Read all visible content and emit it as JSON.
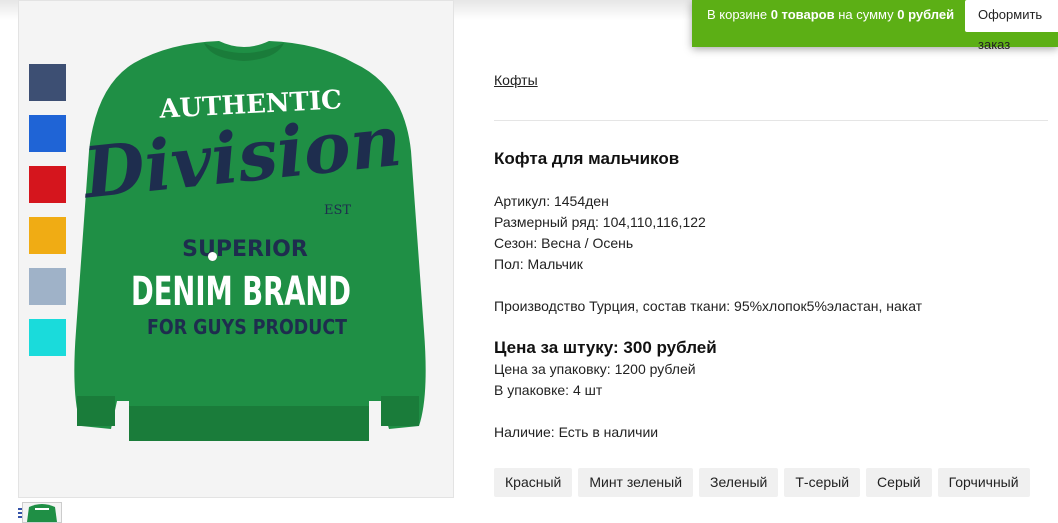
{
  "cart": {
    "prefix": "В корзине",
    "count": "0 товаров",
    "middle": "на сумму",
    "sum": "0 рублей",
    "checkout_label": "Оформить заказ"
  },
  "breadcrumb": "Кофты",
  "product": {
    "title": "Кофта для мальчиков",
    "article": "Артикул: 1454ден",
    "sizes": "Размерный ряд: 104,110,116,122",
    "season": "Сезон: Весна / Осень",
    "gender": "Пол: Мальчик",
    "composition": "Производство Турция, состав ткани: 95%хлопок5%эластан, накат",
    "price_piece": "Цена за штуку: 300 рублей",
    "price_pack": "Цена за упаковку: 1200 рублей",
    "pack_qty": "В упаковке: 4 шт",
    "availability": "Наличие: Есть в наличии"
  },
  "image_print": {
    "authentic": "AUTHENTIC",
    "division": "Division",
    "est": "EST",
    "superior": "SUPERIOR",
    "denim": "DENIM BRAND",
    "for_guys": "FOR GUYS PRODUCT"
  },
  "swatch_colors": [
    "#3d4f73",
    "#1f64d6",
    "#d5151d",
    "#f0ac14",
    "#9fb2c8",
    "#1adbdb"
  ],
  "sweater_color": "#1f8f45",
  "color_options": [
    "Красный",
    "Минт зеленый",
    "Зеленый",
    "Т-серый",
    "Серый",
    "Горчичный"
  ]
}
